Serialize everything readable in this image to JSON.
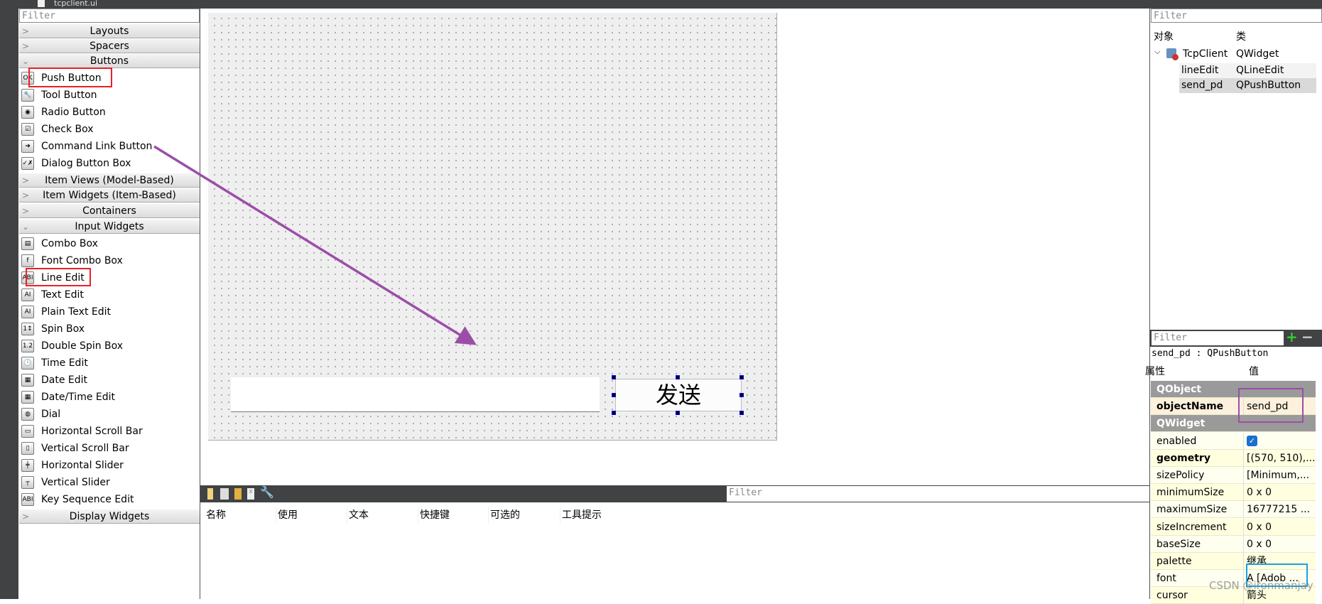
{
  "window": {
    "tab_title": "tcpclient.ui"
  },
  "widget_box": {
    "filter_placeholder": "Filter",
    "categories": {
      "layouts": "Layouts",
      "spacers": "Spacers",
      "buttons": "Buttons",
      "item_views": "Item Views (Model-Based)",
      "item_widgets": "Item Widgets (Item-Based)",
      "containers": "Containers",
      "input_widgets": "Input Widgets",
      "display_widgets": "Display Widgets"
    },
    "buttons": [
      "Push Button",
      "Tool Button",
      "Radio Button",
      "Check Box",
      "Command Link Button",
      "Dialog Button Box"
    ],
    "input_widgets": [
      "Combo Box",
      "Font Combo Box",
      "Line Edit",
      "Text Edit",
      "Plain Text Edit",
      "Spin Box",
      "Double Spin Box",
      "Time Edit",
      "Date Edit",
      "Date/Time Edit",
      "Dial",
      "Horizontal Scroll Bar",
      "Vertical Scroll Bar",
      "Horizontal Slider",
      "Vertical Slider",
      "Key Sequence Edit"
    ]
  },
  "form": {
    "line_edit_value": "",
    "push_button_label": "发送"
  },
  "action_editor": {
    "filter_placeholder": "Filter",
    "columns": [
      "名称",
      "使用",
      "文本",
      "快捷键",
      "可选的",
      "工具提示"
    ]
  },
  "object_inspector": {
    "filter_placeholder": "Filter",
    "columns": [
      "对象",
      "类"
    ],
    "rows": [
      {
        "object": "TcpClient",
        "class": "QWidget"
      },
      {
        "object": "lineEdit",
        "class": "QLineEdit"
      },
      {
        "object": "send_pd",
        "class": "QPushButton"
      }
    ]
  },
  "property_editor": {
    "filter_placeholder": "Filter",
    "subject": "send_pd : QPushButton",
    "columns": [
      "属性",
      "值"
    ],
    "rows": [
      {
        "name": "QObject",
        "value": "",
        "group": true
      },
      {
        "name": "objectName",
        "value": "send_pd",
        "bold": true
      },
      {
        "name": "QWidget",
        "value": "",
        "group": true
      },
      {
        "name": "enabled",
        "value": "✓"
      },
      {
        "name": "geometry",
        "value": "[(570, 510),...",
        "bold": true
      },
      {
        "name": "sizePolicy",
        "value": "[Minimum,..."
      },
      {
        "name": "minimumSize",
        "value": "0 x 0"
      },
      {
        "name": "maximumSize",
        "value": "16777215 ..."
      },
      {
        "name": "sizeIncrement",
        "value": "0 x 0"
      },
      {
        "name": "baseSize",
        "value": "0 x 0"
      },
      {
        "name": "palette",
        "value": "继承"
      },
      {
        "name": "font",
        "value": "A [Adob ..."
      },
      {
        "name": "cursor",
        "value": "箭头"
      }
    ]
  },
  "watermark": "CSDN @ironmanjay",
  "colors": {
    "highlight_red": "#e8202a",
    "highlight_purple": "#9b4ea8",
    "highlight_blue": "#1aa0e8",
    "arrow": "#9b4ea8",
    "dark": "#404244"
  }
}
